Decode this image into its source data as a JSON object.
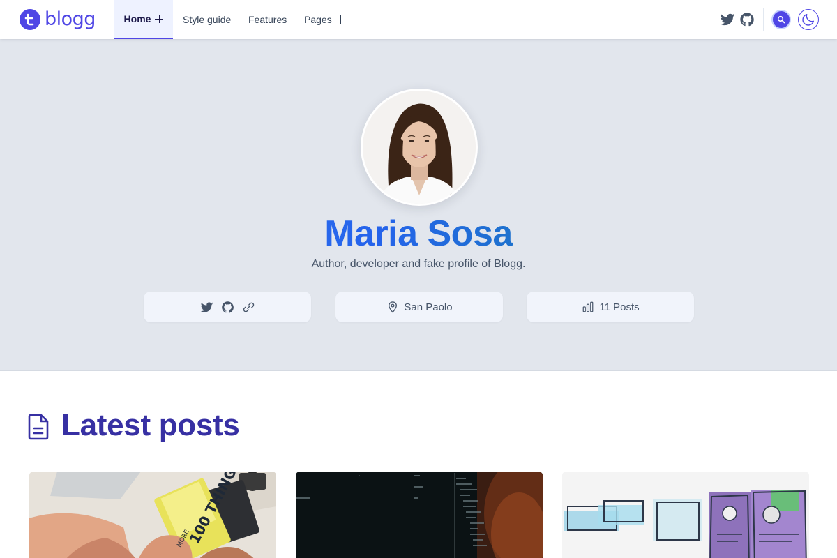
{
  "brand": {
    "name": "blogg",
    "color": "#4f46e5"
  },
  "nav": {
    "items": [
      {
        "label": "Home",
        "active": true,
        "has_submenu": true
      },
      {
        "label": "Style guide",
        "active": false,
        "has_submenu": false
      },
      {
        "label": "Features",
        "active": false,
        "has_submenu": false
      },
      {
        "label": "Pages",
        "active": false,
        "has_submenu": true
      }
    ],
    "icons": [
      "twitter-icon",
      "github-icon",
      "search-icon",
      "moon-icon"
    ]
  },
  "profile": {
    "name": "Maria Sosa",
    "bio": "Author, developer and fake profile of Blogg.",
    "social_icons": [
      "twitter-icon",
      "github-icon",
      "link-icon"
    ],
    "location": "San Paolo",
    "posts": "11 Posts"
  },
  "latest": {
    "title": "Latest posts",
    "cards": [
      {
        "image": "hands-fist-bump-photo"
      },
      {
        "image": "code-screen-photo"
      },
      {
        "image": "wireframe-sketches-photo"
      }
    ],
    "card1_book_text": "100 THINGS",
    "card1_book_small": "MORE"
  },
  "colors": {
    "accent": "#4f46e5",
    "heading": "#3730a3",
    "hero_bg": "#e2e6ed",
    "name_gradient_start": "#3b82f6",
    "name_gradient_end": "#0d9488"
  }
}
